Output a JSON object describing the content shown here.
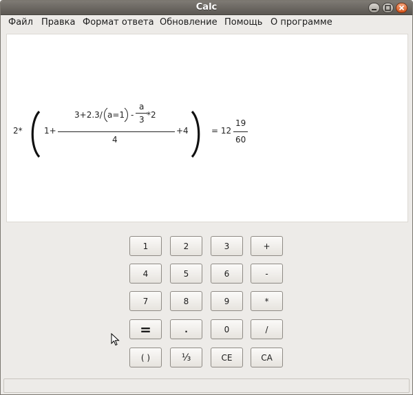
{
  "window": {
    "title": "Calc",
    "controls": [
      "minimize-icon",
      "maximize-icon",
      "close-icon"
    ]
  },
  "menu": [
    "Файл",
    "Правка",
    "Формат ответа",
    "Обновление",
    "Помощь",
    "О программе"
  ],
  "display": {
    "prefix": "2*",
    "inner_prefix": "1+",
    "numerator_left": "3+2.3/",
    "paren_content": "a=1",
    "minus": "-",
    "sub_numerator": "a",
    "sub_denominator": "3",
    "numerator_right": "*2",
    "denominator": "4",
    "inner_suffix": "+4",
    "equals": "= 12",
    "result_numerator": "19",
    "result_denominator": "60"
  },
  "keypad": [
    [
      "1",
      "2",
      "3",
      "+"
    ],
    [
      "4",
      "5",
      "6",
      "-"
    ],
    [
      "7",
      "8",
      "9",
      "*"
    ],
    [
      "=",
      ".",
      "0",
      "/"
    ],
    [
      "( )",
      "⅓",
      "CE",
      "CA"
    ]
  ],
  "colors": {
    "titlebar": "#6b6761",
    "window_bg": "#edebe8",
    "display_bg": "#ffffff",
    "close_button": "#e0641f"
  }
}
